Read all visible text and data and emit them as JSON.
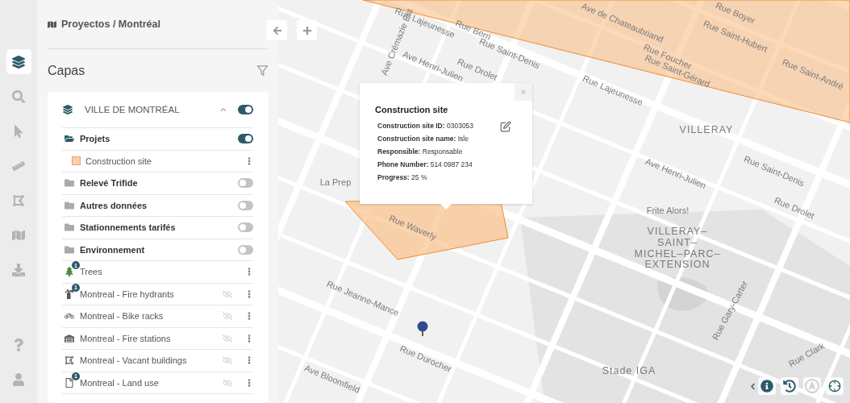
{
  "rail_items": [
    {
      "selected": true
    },
    {
      "selected": false
    },
    {
      "selected": false
    },
    {
      "selected": false
    },
    {
      "selected": false
    },
    {
      "selected": false
    },
    {
      "selected": false
    }
  ],
  "breadcrumb": "Proyectos / Montréal",
  "panel_title": "Capas",
  "source": {
    "label": "VILLE DE MONTRÉAL",
    "expanded": true,
    "on": true
  },
  "layers": [
    {
      "kind": "folder",
      "label": "Projets",
      "open": true,
      "on": true,
      "children": [
        {
          "kind": "swatch",
          "label": "Construction site",
          "color": "#f9cfae"
        }
      ]
    },
    {
      "kind": "folder",
      "label": "Relevé Trifide",
      "open": false,
      "on": false
    },
    {
      "kind": "folder",
      "label": "Autres données",
      "open": false,
      "on": false
    },
    {
      "kind": "folder",
      "label": "Stationnements tarifés",
      "open": false,
      "on": false
    },
    {
      "kind": "folder",
      "label": "Environnement",
      "open": false,
      "on": false
    },
    {
      "kind": "layer",
      "label": "Trees",
      "badge": "1",
      "visible": true
    },
    {
      "kind": "layer",
      "label": "Montreal - Fire hydrants",
      "badge": "1",
      "visible": false
    },
    {
      "kind": "layer",
      "label": "Montreal - Bike racks",
      "visible": false
    },
    {
      "kind": "layer",
      "label": "Montreal - Fire stations",
      "visible": false
    },
    {
      "kind": "layer",
      "label": "Montreal - Vacant buildings",
      "visible": false
    },
    {
      "kind": "layer",
      "label": "Montreal - Land use",
      "badge": "1",
      "visible": false
    }
  ],
  "popup": {
    "title": "Construction site",
    "close": "×",
    "fields": [
      {
        "label": "Construction site ID:",
        "value": "0303053"
      },
      {
        "label": "Construction site name:",
        "value": "Isle"
      },
      {
        "label": "Responsible:",
        "value": "Responsable"
      },
      {
        "label": "Phone Number:",
        "value": "514 0987 234"
      },
      {
        "label": "Progress:",
        "value": "25 %"
      }
    ]
  },
  "map_labels": [
    "Rue Lajeunesse",
    "Rue Berri",
    "Rue Saint-Denis",
    "Rue Drolet",
    "Ave Henri-Julien",
    "Ave de Chateaubriand",
    "Rue Boyer",
    "Rue Saint-Hubert",
    "Rue Foucher",
    "Rue Saint-Gérard",
    "Rue Saint-André",
    "Rue Lajeunesse",
    "VILLERAY",
    "Ave Henri-Julien",
    "Rue Saint-Denis",
    "Frite Alors!",
    "Rue Drolet",
    "La Prep",
    "Rue Waverly",
    "Ave Crémazie Est",
    "Rue Jeanne-Mance",
    "Rue Durocher",
    "Ave Bloomfield",
    "VILLERAY–\nSAINT–\nMICHEL–PARC–\nEXTENSION",
    "Rue Gary-Carter",
    "Stade IGA",
    "Rue Clark"
  ],
  "map_controls": [
    {
      "disabled": false
    },
    {
      "disabled": false
    },
    {
      "disabled": true
    },
    {
      "disabled": false
    }
  ]
}
